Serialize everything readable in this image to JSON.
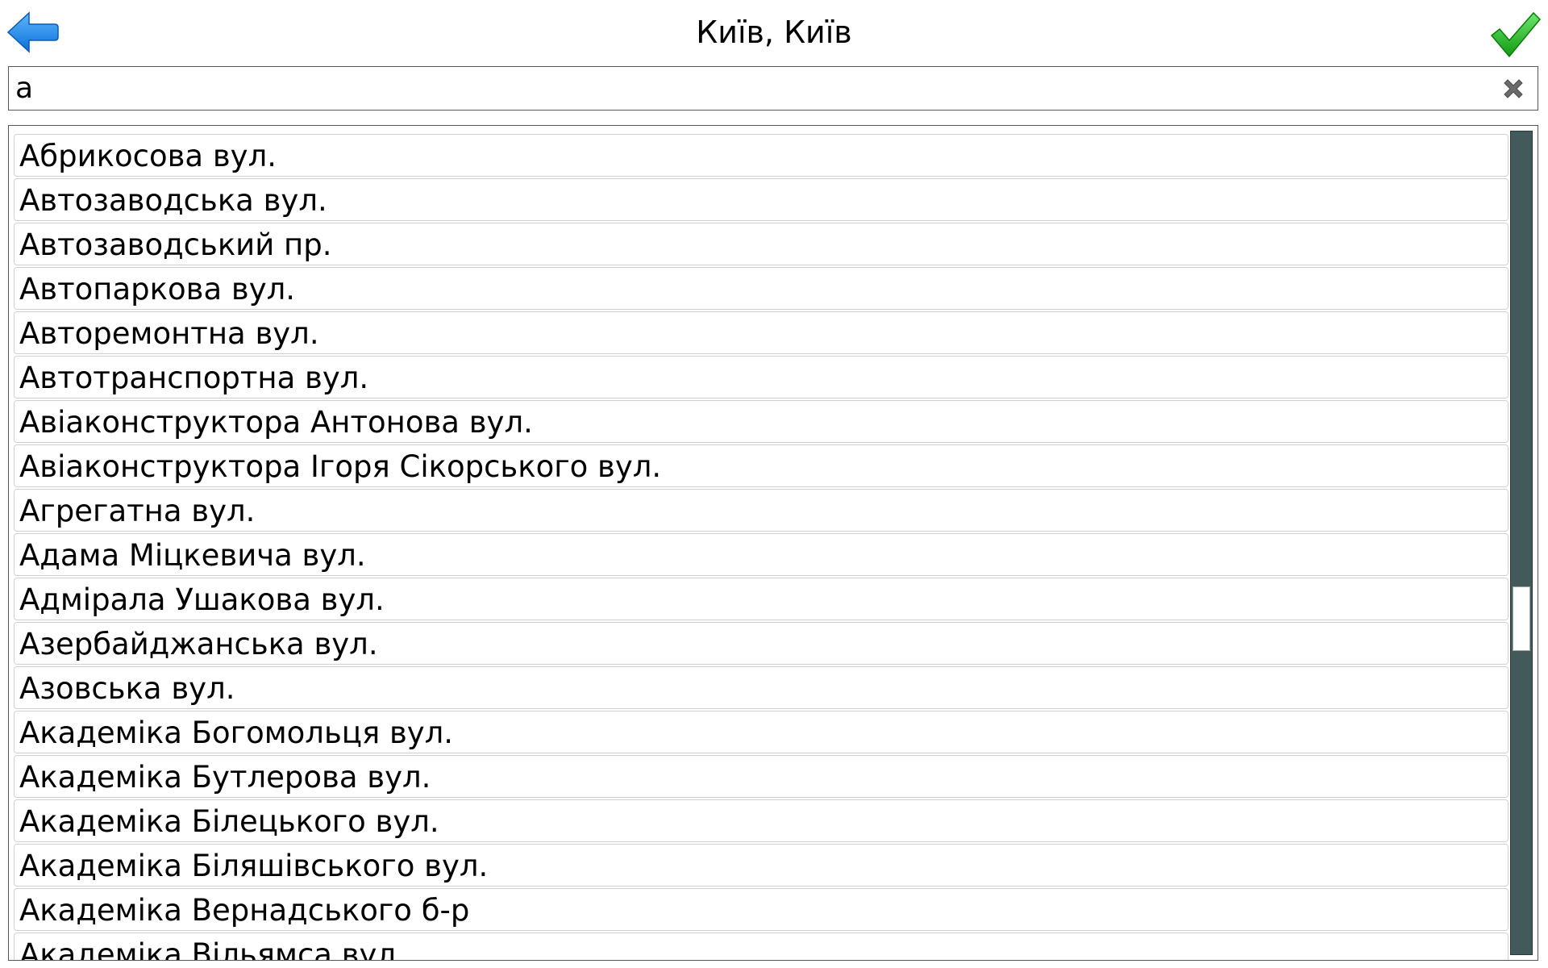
{
  "header": {
    "title": "Київ, Київ",
    "back_icon": "arrow-left-icon",
    "confirm_icon": "checkmark-icon",
    "colors": {
      "back": "#1e90ff",
      "confirm": "#22b022"
    }
  },
  "search": {
    "value": "а",
    "clear_icon": "close-icon"
  },
  "list": {
    "items": [
      "Абрикосова вул.",
      "Автозаводська вул.",
      "Автозаводський пр.",
      "Автопаркова вул.",
      "Авторемонтна вул.",
      "Автотранспортна вул.",
      "Авіаконструктора Антонова вул.",
      "Авіаконструктора Ігоря Сікорського вул.",
      "Агрегатна вул.",
      "Адама Міцкевича вул.",
      "Адмірала Ушакова вул.",
      "Азербайджанська вул.",
      "Азовська вул.",
      "Академіка Богомольця вул.",
      "Академіка Бутлерова вул.",
      "Академіка Білецького вул.",
      "Академіка Біляшівського вул.",
      "Академіка Вернадського б-р",
      "Академіка Вільямса вул."
    ]
  },
  "scrollbar": {
    "position_fraction": 0.6,
    "colors": {
      "track": "#425b5a",
      "thumb": "#ffffff"
    }
  }
}
